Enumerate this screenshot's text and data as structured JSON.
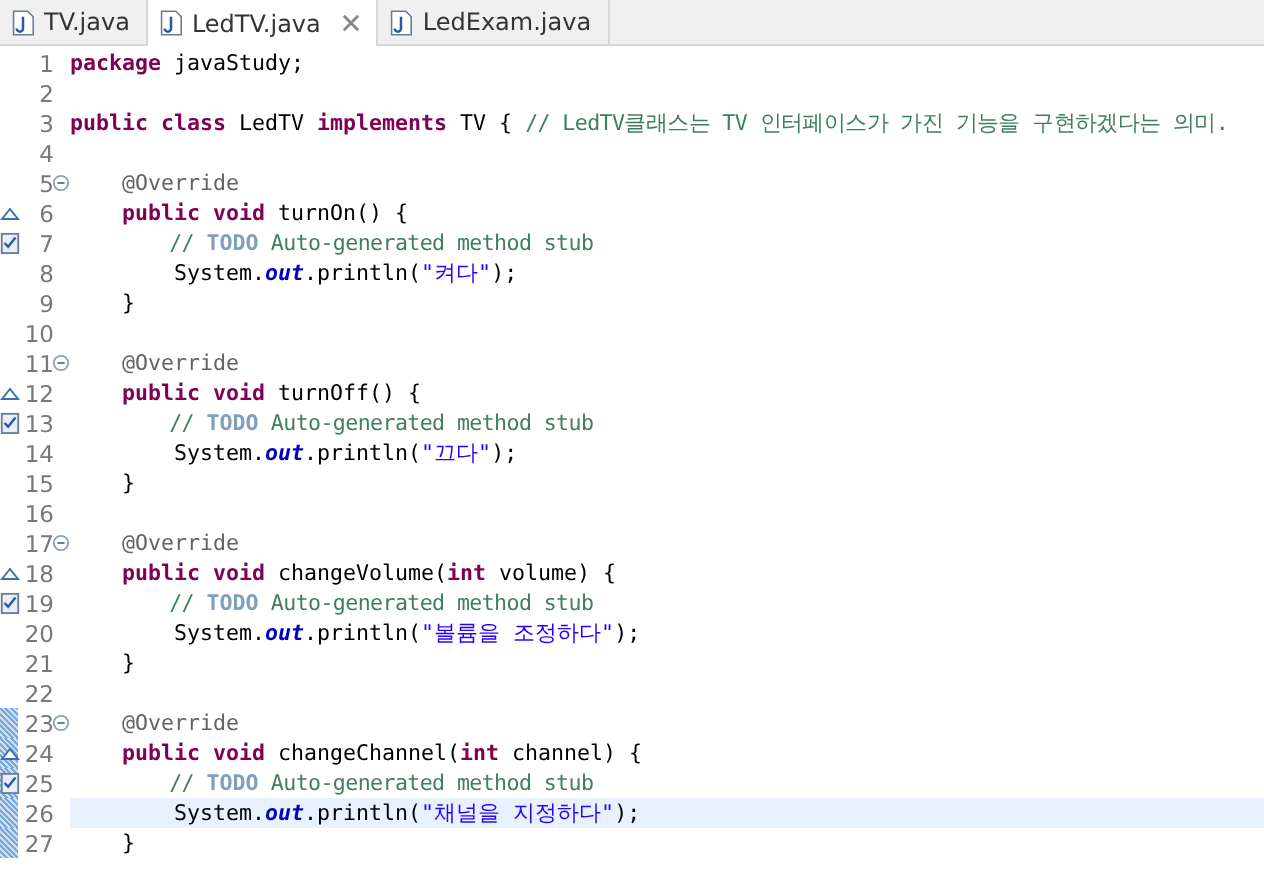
{
  "tabs": [
    {
      "label": "TV.java",
      "selected": false,
      "closable": false
    },
    {
      "label": "LedTV.java",
      "selected": true,
      "closable": true
    },
    {
      "label": "LedExam.java",
      "selected": false,
      "closable": false
    }
  ],
  "lines": [
    {
      "number": "1",
      "fold": false,
      "kind": "plain",
      "changed": false,
      "current": false,
      "tokens": [
        {
          "t": "package",
          "kind": "keyword"
        },
        {
          "t": " javaStudy;",
          "kind": "plain"
        }
      ]
    },
    {
      "number": "2",
      "fold": false,
      "kind": "plain",
      "changed": false,
      "current": false
    },
    {
      "number": "3",
      "fold": false,
      "kind": "plain",
      "changed": false,
      "current": false,
      "tokens": [
        {
          "t": "public class",
          "kind": "keyword"
        },
        {
          "t": " LedTV ",
          "kind": "plain"
        },
        {
          "t": "implements",
          "kind": "keyword"
        },
        {
          "t": " TV { ",
          "kind": "plain"
        },
        {
          "t": "// LedTV클래스는 TV 인터페이스가 가진 기능을 구현하겠다는 의미.",
          "kind": "comment"
        }
      ]
    },
    {
      "number": "4",
      "fold": false,
      "kind": "plain",
      "changed": false,
      "current": false
    },
    {
      "number": "5",
      "fold": true,
      "kind": "plain",
      "changed": false,
      "current": false,
      "tokens": [
        {
          "t": "    @Override",
          "kind": "annotation"
        }
      ]
    },
    {
      "number": "6",
      "fold": false,
      "kind": "override",
      "changed": false,
      "current": false,
      "tokens": [
        {
          "t": "    public void",
          "kind": "keyword"
        },
        {
          "t": " turnOn() {",
          "kind": "plain"
        }
      ]
    },
    {
      "number": "7",
      "fold": false,
      "kind": "task",
      "changed": false,
      "current": false,
      "tokens": [
        {
          "t": "        // ",
          "kind": "comment"
        },
        {
          "t": "TODO",
          "kind": "todo"
        },
        {
          "t": " Auto-generated method stub",
          "kind": "comment"
        }
      ]
    },
    {
      "number": "8",
      "fold": false,
      "kind": "plain",
      "changed": false,
      "current": false,
      "tokens": [
        {
          "t": "        System.",
          "kind": "plain"
        },
        {
          "t": "out",
          "kind": "field"
        },
        {
          "t": ".println(",
          "kind": "plain"
        },
        {
          "t": "\"켜다\"",
          "kind": "string"
        },
        {
          "t": ");",
          "kind": "plain"
        }
      ]
    },
    {
      "number": "9",
      "fold": false,
      "kind": "plain",
      "changed": false,
      "current": false,
      "tokens": [
        {
          "t": "    }",
          "kind": "plain"
        }
      ]
    },
    {
      "number": "10",
      "fold": false,
      "kind": "plain",
      "changed": false,
      "current": false
    },
    {
      "number": "11",
      "fold": true,
      "kind": "plain",
      "changed": false,
      "current": false,
      "tokens": [
        {
          "t": "    @Override",
          "kind": "annotation"
        }
      ]
    },
    {
      "number": "12",
      "fold": false,
      "kind": "override",
      "changed": false,
      "current": false,
      "tokens": [
        {
          "t": "    public void",
          "kind": "keyword"
        },
        {
          "t": " turnOff() {",
          "kind": "plain"
        }
      ]
    },
    {
      "number": "13",
      "fold": false,
      "kind": "task",
      "changed": false,
      "current": false,
      "tokens": [
        {
          "t": "        // ",
          "kind": "comment"
        },
        {
          "t": "TODO",
          "kind": "todo"
        },
        {
          "t": " Auto-generated method stub",
          "kind": "comment"
        }
      ]
    },
    {
      "number": "14",
      "fold": false,
      "kind": "plain",
      "changed": false,
      "current": false,
      "tokens": [
        {
          "t": "        System.",
          "kind": "plain"
        },
        {
          "t": "out",
          "kind": "field"
        },
        {
          "t": ".println(",
          "kind": "plain"
        },
        {
          "t": "\"끄다\"",
          "kind": "string"
        },
        {
          "t": ");",
          "kind": "plain"
        }
      ]
    },
    {
      "number": "15",
      "fold": false,
      "kind": "plain",
      "changed": false,
      "current": false,
      "tokens": [
        {
          "t": "    }",
          "kind": "plain"
        }
      ]
    },
    {
      "number": "16",
      "fold": false,
      "kind": "plain",
      "changed": false,
      "current": false
    },
    {
      "number": "17",
      "fold": true,
      "kind": "plain",
      "changed": false,
      "current": false,
      "tokens": [
        {
          "t": "    @Override",
          "kind": "annotation"
        }
      ]
    },
    {
      "number": "18",
      "fold": false,
      "kind": "override",
      "changed": false,
      "current": false,
      "tokens": [
        {
          "t": "    public void",
          "kind": "keyword"
        },
        {
          "t": " changeVolume(",
          "kind": "plain"
        },
        {
          "t": "int",
          "kind": "keyword"
        },
        {
          "t": " volume) {",
          "kind": "plain"
        }
      ]
    },
    {
      "number": "19",
      "fold": false,
      "kind": "task",
      "changed": false,
      "current": false,
      "tokens": [
        {
          "t": "        // ",
          "kind": "comment"
        },
        {
          "t": "TODO",
          "kind": "todo"
        },
        {
          "t": " Auto-generated method stub",
          "kind": "comment"
        }
      ]
    },
    {
      "number": "20",
      "fold": false,
      "kind": "plain",
      "changed": false,
      "current": false,
      "tokens": [
        {
          "t": "        System.",
          "kind": "plain"
        },
        {
          "t": "out",
          "kind": "field"
        },
        {
          "t": ".println(",
          "kind": "plain"
        },
        {
          "t": "\"볼륨을 조정하다\"",
          "kind": "string"
        },
        {
          "t": ");",
          "kind": "plain"
        }
      ]
    },
    {
      "number": "21",
      "fold": false,
      "kind": "plain",
      "changed": false,
      "current": false,
      "tokens": [
        {
          "t": "    }",
          "kind": "plain"
        }
      ]
    },
    {
      "number": "22",
      "fold": false,
      "kind": "plain",
      "changed": false,
      "current": false
    },
    {
      "number": "23",
      "fold": true,
      "kind": "plain",
      "changed": true,
      "current": false,
      "tokens": [
        {
          "t": "    @Override",
          "kind": "annotation"
        }
      ]
    },
    {
      "number": "24",
      "fold": false,
      "kind": "override",
      "changed": true,
      "current": false,
      "tokens": [
        {
          "t": "    public void",
          "kind": "keyword"
        },
        {
          "t": " changeChannel(",
          "kind": "plain"
        },
        {
          "t": "int",
          "kind": "keyword"
        },
        {
          "t": " channel) {",
          "kind": "plain"
        }
      ]
    },
    {
      "number": "25",
      "fold": false,
      "kind": "task",
      "changed": true,
      "current": false,
      "tokens": [
        {
          "t": "        // ",
          "kind": "comment"
        },
        {
          "t": "TODO",
          "kind": "todo"
        },
        {
          "t": " Auto-generated method stub",
          "kind": "comment"
        }
      ]
    },
    {
      "number": "26",
      "fold": false,
      "kind": "plain",
      "changed": true,
      "current": true,
      "tokens": [
        {
          "t": "        System.",
          "kind": "plain"
        },
        {
          "t": "out",
          "kind": "field"
        },
        {
          "t": ".println(",
          "kind": "plain"
        },
        {
          "t": "\"채널을 지정하다\"",
          "kind": "string"
        },
        {
          "t": ");",
          "kind": "plain"
        }
      ]
    },
    {
      "number": "27",
      "fold": false,
      "kind": "plain",
      "changed": true,
      "current": false,
      "tokens": [
        {
          "t": "    }",
          "kind": "plain"
        }
      ]
    }
  ]
}
